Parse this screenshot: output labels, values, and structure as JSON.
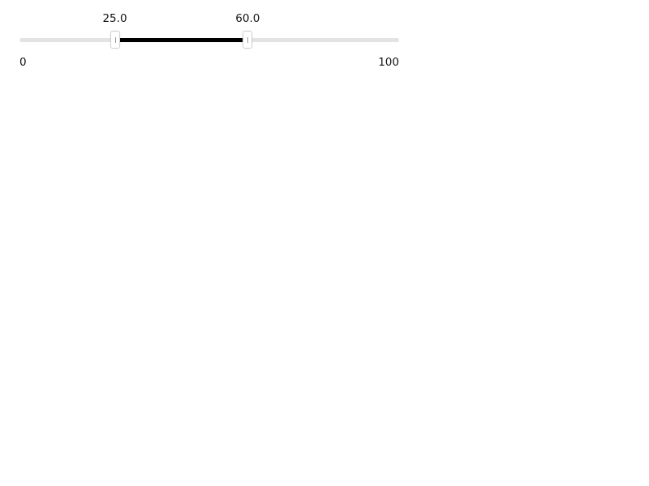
{
  "slider": {
    "min": 0,
    "max": 100,
    "low": 25.0,
    "high": 60.0,
    "low_label": "25.0",
    "high_label": "60.0",
    "min_label": "0",
    "max_label": "100",
    "track_color": "#e3e3e3",
    "fill_color": "#000000"
  }
}
